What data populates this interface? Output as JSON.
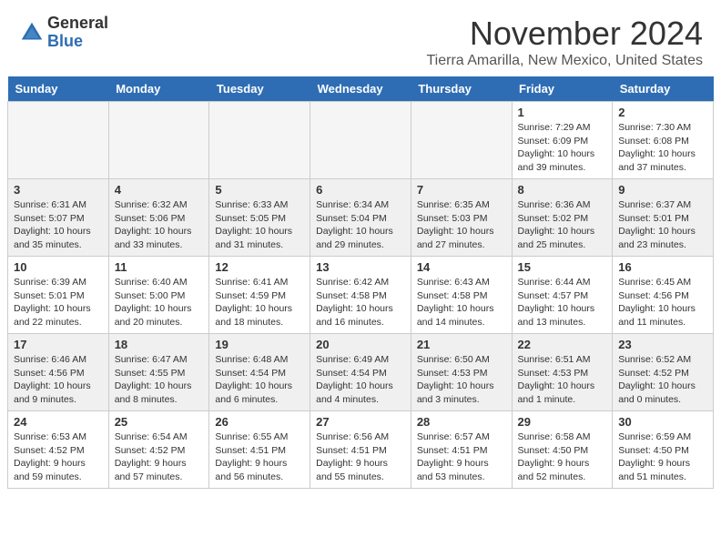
{
  "header": {
    "logo_general": "General",
    "logo_blue": "Blue",
    "month_title": "November 2024",
    "location": "Tierra Amarilla, New Mexico, United States"
  },
  "weekdays": [
    "Sunday",
    "Monday",
    "Tuesday",
    "Wednesday",
    "Thursday",
    "Friday",
    "Saturday"
  ],
  "weeks": [
    [
      {
        "day": "",
        "empty": true
      },
      {
        "day": "",
        "empty": true
      },
      {
        "day": "",
        "empty": true
      },
      {
        "day": "",
        "empty": true
      },
      {
        "day": "",
        "empty": true
      },
      {
        "day": "1",
        "sunrise": "Sunrise: 7:29 AM",
        "sunset": "Sunset: 6:09 PM",
        "daylight": "Daylight: 10 hours and 39 minutes."
      },
      {
        "day": "2",
        "sunrise": "Sunrise: 7:30 AM",
        "sunset": "Sunset: 6:08 PM",
        "daylight": "Daylight: 10 hours and 37 minutes."
      }
    ],
    [
      {
        "day": "3",
        "sunrise": "Sunrise: 6:31 AM",
        "sunset": "Sunset: 5:07 PM",
        "daylight": "Daylight: 10 hours and 35 minutes."
      },
      {
        "day": "4",
        "sunrise": "Sunrise: 6:32 AM",
        "sunset": "Sunset: 5:06 PM",
        "daylight": "Daylight: 10 hours and 33 minutes."
      },
      {
        "day": "5",
        "sunrise": "Sunrise: 6:33 AM",
        "sunset": "Sunset: 5:05 PM",
        "daylight": "Daylight: 10 hours and 31 minutes."
      },
      {
        "day": "6",
        "sunrise": "Sunrise: 6:34 AM",
        "sunset": "Sunset: 5:04 PM",
        "daylight": "Daylight: 10 hours and 29 minutes."
      },
      {
        "day": "7",
        "sunrise": "Sunrise: 6:35 AM",
        "sunset": "Sunset: 5:03 PM",
        "daylight": "Daylight: 10 hours and 27 minutes."
      },
      {
        "day": "8",
        "sunrise": "Sunrise: 6:36 AM",
        "sunset": "Sunset: 5:02 PM",
        "daylight": "Daylight: 10 hours and 25 minutes."
      },
      {
        "day": "9",
        "sunrise": "Sunrise: 6:37 AM",
        "sunset": "Sunset: 5:01 PM",
        "daylight": "Daylight: 10 hours and 23 minutes."
      }
    ],
    [
      {
        "day": "10",
        "sunrise": "Sunrise: 6:39 AM",
        "sunset": "Sunset: 5:01 PM",
        "daylight": "Daylight: 10 hours and 22 minutes."
      },
      {
        "day": "11",
        "sunrise": "Sunrise: 6:40 AM",
        "sunset": "Sunset: 5:00 PM",
        "daylight": "Daylight: 10 hours and 20 minutes."
      },
      {
        "day": "12",
        "sunrise": "Sunrise: 6:41 AM",
        "sunset": "Sunset: 4:59 PM",
        "daylight": "Daylight: 10 hours and 18 minutes."
      },
      {
        "day": "13",
        "sunrise": "Sunrise: 6:42 AM",
        "sunset": "Sunset: 4:58 PM",
        "daylight": "Daylight: 10 hours and 16 minutes."
      },
      {
        "day": "14",
        "sunrise": "Sunrise: 6:43 AM",
        "sunset": "Sunset: 4:58 PM",
        "daylight": "Daylight: 10 hours and 14 minutes."
      },
      {
        "day": "15",
        "sunrise": "Sunrise: 6:44 AM",
        "sunset": "Sunset: 4:57 PM",
        "daylight": "Daylight: 10 hours and 13 minutes."
      },
      {
        "day": "16",
        "sunrise": "Sunrise: 6:45 AM",
        "sunset": "Sunset: 4:56 PM",
        "daylight": "Daylight: 10 hours and 11 minutes."
      }
    ],
    [
      {
        "day": "17",
        "sunrise": "Sunrise: 6:46 AM",
        "sunset": "Sunset: 4:56 PM",
        "daylight": "Daylight: 10 hours and 9 minutes."
      },
      {
        "day": "18",
        "sunrise": "Sunrise: 6:47 AM",
        "sunset": "Sunset: 4:55 PM",
        "daylight": "Daylight: 10 hours and 8 minutes."
      },
      {
        "day": "19",
        "sunrise": "Sunrise: 6:48 AM",
        "sunset": "Sunset: 4:54 PM",
        "daylight": "Daylight: 10 hours and 6 minutes."
      },
      {
        "day": "20",
        "sunrise": "Sunrise: 6:49 AM",
        "sunset": "Sunset: 4:54 PM",
        "daylight": "Daylight: 10 hours and 4 minutes."
      },
      {
        "day": "21",
        "sunrise": "Sunrise: 6:50 AM",
        "sunset": "Sunset: 4:53 PM",
        "daylight": "Daylight: 10 hours and 3 minutes."
      },
      {
        "day": "22",
        "sunrise": "Sunrise: 6:51 AM",
        "sunset": "Sunset: 4:53 PM",
        "daylight": "Daylight: 10 hours and 1 minute."
      },
      {
        "day": "23",
        "sunrise": "Sunrise: 6:52 AM",
        "sunset": "Sunset: 4:52 PM",
        "daylight": "Daylight: 10 hours and 0 minutes."
      }
    ],
    [
      {
        "day": "24",
        "sunrise": "Sunrise: 6:53 AM",
        "sunset": "Sunset: 4:52 PM",
        "daylight": "Daylight: 9 hours and 59 minutes."
      },
      {
        "day": "25",
        "sunrise": "Sunrise: 6:54 AM",
        "sunset": "Sunset: 4:52 PM",
        "daylight": "Daylight: 9 hours and 57 minutes."
      },
      {
        "day": "26",
        "sunrise": "Sunrise: 6:55 AM",
        "sunset": "Sunset: 4:51 PM",
        "daylight": "Daylight: 9 hours and 56 minutes."
      },
      {
        "day": "27",
        "sunrise": "Sunrise: 6:56 AM",
        "sunset": "Sunset: 4:51 PM",
        "daylight": "Daylight: 9 hours and 55 minutes."
      },
      {
        "day": "28",
        "sunrise": "Sunrise: 6:57 AM",
        "sunset": "Sunset: 4:51 PM",
        "daylight": "Daylight: 9 hours and 53 minutes."
      },
      {
        "day": "29",
        "sunrise": "Sunrise: 6:58 AM",
        "sunset": "Sunset: 4:50 PM",
        "daylight": "Daylight: 9 hours and 52 minutes."
      },
      {
        "day": "30",
        "sunrise": "Sunrise: 6:59 AM",
        "sunset": "Sunset: 4:50 PM",
        "daylight": "Daylight: 9 hours and 51 minutes."
      }
    ]
  ]
}
